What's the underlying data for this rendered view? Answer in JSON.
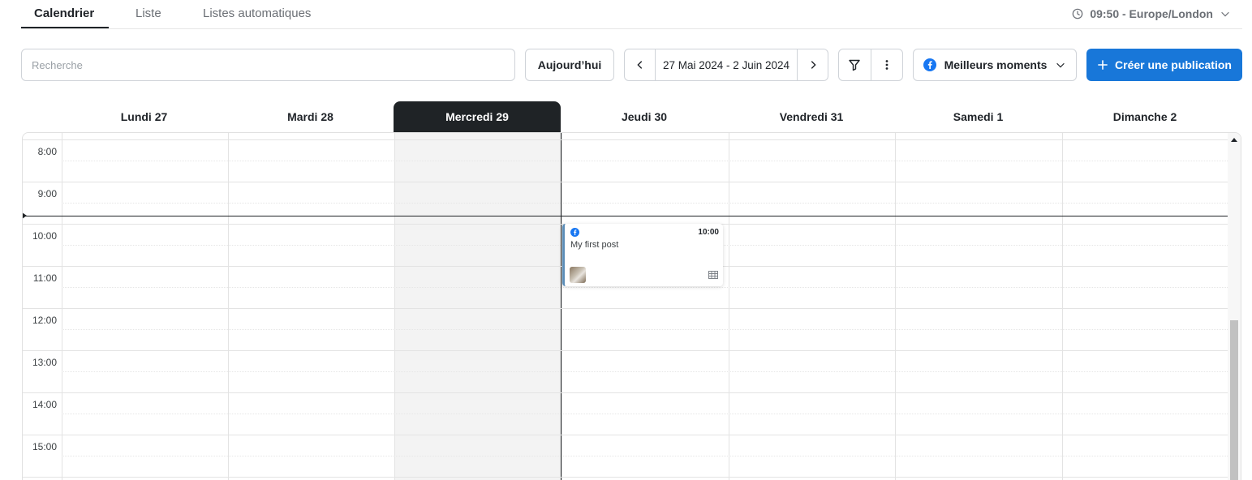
{
  "tabs": [
    {
      "label": "Calendrier",
      "active": true
    },
    {
      "label": "Liste",
      "active": false
    },
    {
      "label": "Listes automatiques",
      "active": false
    }
  ],
  "timezone": {
    "label": "09:50 - Europe/London",
    "icon": "clock-icon"
  },
  "toolbar": {
    "search_placeholder": "Recherche",
    "today_label": "Aujourd’hui",
    "date_range": "27 Mai 2024 - 2 Juin 2024",
    "best_times_label": "Meilleurs moments",
    "create_label": "Créer une publication"
  },
  "days": [
    "Lundi 27",
    "Mardi 28",
    "Mercredi 29",
    "Jeudi 30",
    "Vendredi 31",
    "Samedi 1",
    "Dimanche 2"
  ],
  "today_index": 2,
  "hours": [
    "8:00",
    "9:00",
    "10:00",
    "11:00",
    "12:00",
    "13:00",
    "14:00",
    "15:00"
  ],
  "post": {
    "network": "facebook",
    "time": "10:00",
    "text": "My first post",
    "day_index": 3
  },
  "colors": {
    "accent": "#1877d9",
    "today_header": "#1f2326",
    "facebook": "#1877f2"
  }
}
